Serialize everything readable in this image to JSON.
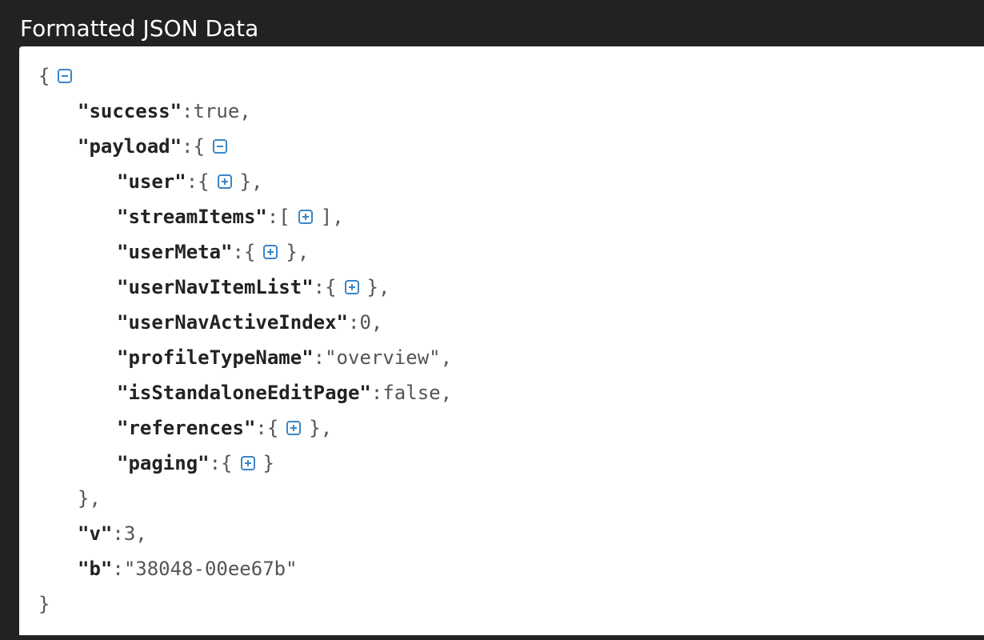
{
  "header": {
    "title": "Formatted JSON Data"
  },
  "tree": {
    "root_open": "{",
    "root_close": "}",
    "success": {
      "key": "\"success\"",
      "value": "true"
    },
    "payload": {
      "key": "\"payload\"",
      "open": "{",
      "close": "},",
      "children": {
        "user": {
          "key": "\"user\"",
          "open": "{",
          "close": "},"
        },
        "streamItems": {
          "key": "\"streamItems\"",
          "open": "[",
          "close": "],"
        },
        "userMeta": {
          "key": "\"userMeta\"",
          "open": "{",
          "close": "},"
        },
        "userNavItemList": {
          "key": "\"userNavItemList\"",
          "open": "{",
          "close": "},"
        },
        "userNavActiveIndex": {
          "key": "\"userNavActiveIndex\"",
          "value": "0"
        },
        "profileTypeName": {
          "key": "\"profileTypeName\"",
          "value": "\"overview\""
        },
        "isStandaloneEditPage": {
          "key": "\"isStandaloneEditPage\"",
          "value": "false"
        },
        "references": {
          "key": "\"references\"",
          "open": "{",
          "close": "},"
        },
        "paging": {
          "key": "\"paging\"",
          "open": "{",
          "close": "}"
        }
      }
    },
    "v": {
      "key": "\"v\"",
      "value": "3"
    },
    "b": {
      "key": "\"b\"",
      "value": "\"38048-00ee67b\""
    }
  },
  "icons": {
    "collapse": "minus-square-icon",
    "expand": "plus-square-icon"
  },
  "colors": {
    "toggle": "#3a86c8",
    "background": "#222222",
    "panel": "#ffffff"
  }
}
